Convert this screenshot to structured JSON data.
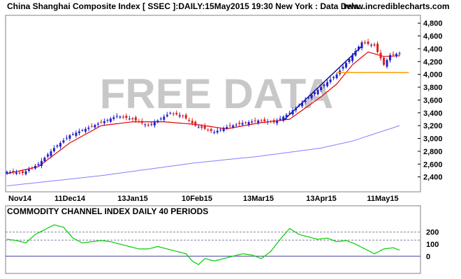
{
  "header": {
    "title": "China Shanghai Composite Index [ SSEC ]:DAILY:15May2015 19:30 New York : Data Dela...",
    "site": "www.incrediblecharts.com"
  },
  "watermark": "FREE DATA",
  "colors": {
    "up": "#2020d0",
    "down": "#e02020",
    "ema": "#e00000",
    "ma": "#8080ff",
    "trendline": "#000080",
    "support": "#ff9900",
    "cci": "#00cc00",
    "refline": "#8080a0"
  },
  "chart_data": [
    {
      "type": "candlestick",
      "title": "China Shanghai Composite Index [ SSEC ]:DAILY:15May2015 19:30 New York : Data Dela...",
      "x_ticks": [
        "Nov14",
        "11Dec14",
        "13Jan15",
        "10Feb15",
        "13Mar15",
        "13Apr15",
        "11May15"
      ],
      "ylim": [
        2200,
        4900
      ],
      "y_ticks": [
        2400,
        2600,
        2800,
        3000,
        3200,
        3400,
        3600,
        3800,
        4000,
        4200,
        4400,
        4600,
        4800
      ],
      "x_range": [
        0,
        125
      ],
      "close_anchors": [
        [
          0,
          2480
        ],
        [
          5,
          2460
        ],
        [
          10,
          2600
        ],
        [
          15,
          2850
        ],
        [
          20,
          3050
        ],
        [
          25,
          3150
        ],
        [
          30,
          3250
        ],
        [
          35,
          3350
        ],
        [
          40,
          3300
        ],
        [
          45,
          3200
        ],
        [
          48,
          3280
        ],
        [
          52,
          3400
        ],
        [
          56,
          3350
        ],
        [
          60,
          3200
        ],
        [
          63,
          3150
        ],
        [
          66,
          3100
        ],
        [
          70,
          3180
        ],
        [
          75,
          3240
        ],
        [
          80,
          3280
        ],
        [
          85,
          3250
        ],
        [
          90,
          3400
        ],
        [
          95,
          3600
        ],
        [
          100,
          3800
        ],
        [
          105,
          4000
        ],
        [
          110,
          4300
        ],
        [
          113,
          4500
        ],
        [
          117,
          4450
        ],
        [
          120,
          4150
        ],
        [
          122,
          4300
        ],
        [
          125,
          4330
        ]
      ],
      "ema_anchors": [
        [
          0,
          2450
        ],
        [
          10,
          2560
        ],
        [
          20,
          2930
        ],
        [
          30,
          3200
        ],
        [
          40,
          3260
        ],
        [
          50,
          3260
        ],
        [
          60,
          3220
        ],
        [
          70,
          3150
        ],
        [
          80,
          3240
        ],
        [
          90,
          3300
        ],
        [
          100,
          3650
        ],
        [
          105,
          3850
        ],
        [
          110,
          4150
        ],
        [
          115,
          4350
        ],
        [
          120,
          4280
        ],
        [
          125,
          4290
        ]
      ],
      "ma_anchors": [
        [
          0,
          2260
        ],
        [
          30,
          2420
        ],
        [
          60,
          2620
        ],
        [
          80,
          2720
        ],
        [
          100,
          2850
        ],
        [
          110,
          2960
        ],
        [
          125,
          3200
        ]
      ],
      "trendline": [
        [
          88,
          3280
        ],
        [
          113,
          4440
        ]
      ],
      "support_line": {
        "x0": 105,
        "x1": 128,
        "y": 4030
      }
    },
    {
      "type": "line",
      "title": "COMMODITY CHANNEL INDEX DAILY 40 PERIODS",
      "ylim": [
        -120,
        320
      ],
      "y_ticks": [
        0,
        100,
        200
      ],
      "ref_lines": [
        0,
        133,
        200
      ],
      "x_range": [
        0,
        125
      ],
      "series": [
        {
          "values": [
            [
              0,
              140
            ],
            [
              3,
              130
            ],
            [
              6,
              110
            ],
            [
              9,
              180
            ],
            [
              12,
              220
            ],
            [
              15,
              260
            ],
            [
              18,
              240
            ],
            [
              21,
              150
            ],
            [
              24,
              110
            ],
            [
              27,
              120
            ],
            [
              30,
              130
            ],
            [
              33,
              120
            ],
            [
              36,
              100
            ],
            [
              39,
              80
            ],
            [
              42,
              60
            ],
            [
              45,
              60
            ],
            [
              48,
              80
            ],
            [
              51,
              60
            ],
            [
              54,
              40
            ],
            [
              57,
              20
            ],
            [
              59,
              -40
            ],
            [
              61,
              -70
            ],
            [
              63,
              -20
            ],
            [
              66,
              -40
            ],
            [
              69,
              -20
            ],
            [
              72,
              0
            ],
            [
              75,
              20
            ],
            [
              78,
              10
            ],
            [
              81,
              -20
            ],
            [
              84,
              40
            ],
            [
              87,
              140
            ],
            [
              90,
              230
            ],
            [
              93,
              180
            ],
            [
              96,
              160
            ],
            [
              99,
              140
            ],
            [
              102,
              150
            ],
            [
              105,
              120
            ],
            [
              108,
              130
            ],
            [
              111,
              100
            ],
            [
              114,
              60
            ],
            [
              117,
              20
            ],
            [
              120,
              60
            ],
            [
              123,
              70
            ],
            [
              125,
              50
            ]
          ]
        }
      ]
    }
  ]
}
